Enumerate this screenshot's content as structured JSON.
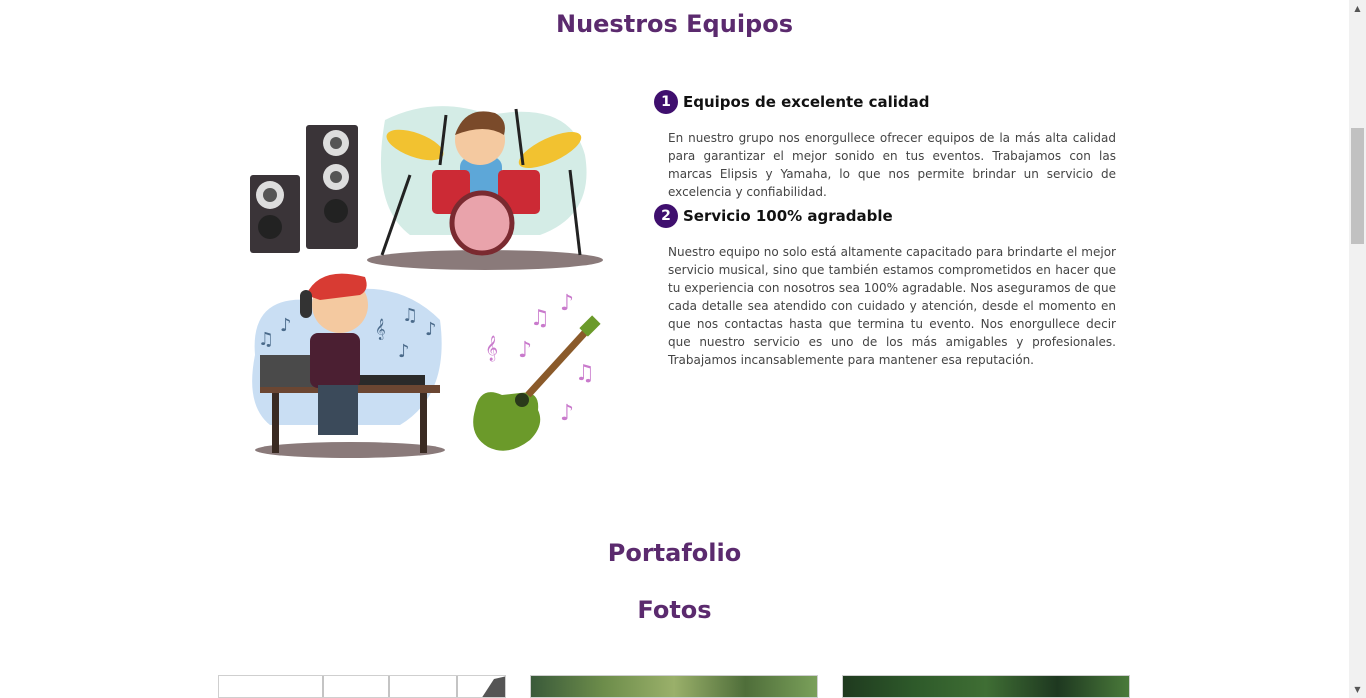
{
  "equipos": {
    "title": "Nuestros Equipos",
    "features": [
      {
        "number": "1",
        "title": "Equipos de excelente calidad",
        "text": "En nuestro grupo nos enorgullece ofrecer equipos de la más alta calidad para garantizar el mejor sonido en tus eventos. Trabajamos con las marcas Elipsis y Yamaha, lo que nos permite brindar un servicio de excelencia y confiabilidad."
      },
      {
        "number": "2",
        "title": "Servicio 100% agradable",
        "text": "Nuestro equipo no solo está altamente capacitado para brindarte el mejor servicio musical, sino que también estamos comprometidos en hacer que tu experiencia con nosotros sea 100% agradable. Nos aseguramos de que cada detalle sea atendido con cuidado y atención, desde el momento en que nos contactas hasta que termina tu evento. Nos enorgullece decir que nuestro servicio es uno de los más amigables y profesionales. Trabajamos incansablemente para mantener esa reputación."
      }
    ]
  },
  "portafolio": {
    "title": "Portafolio",
    "subtitle": "Fotos"
  },
  "colors": {
    "heading": "#5b2a6e",
    "badge": "#3f0f6e"
  }
}
